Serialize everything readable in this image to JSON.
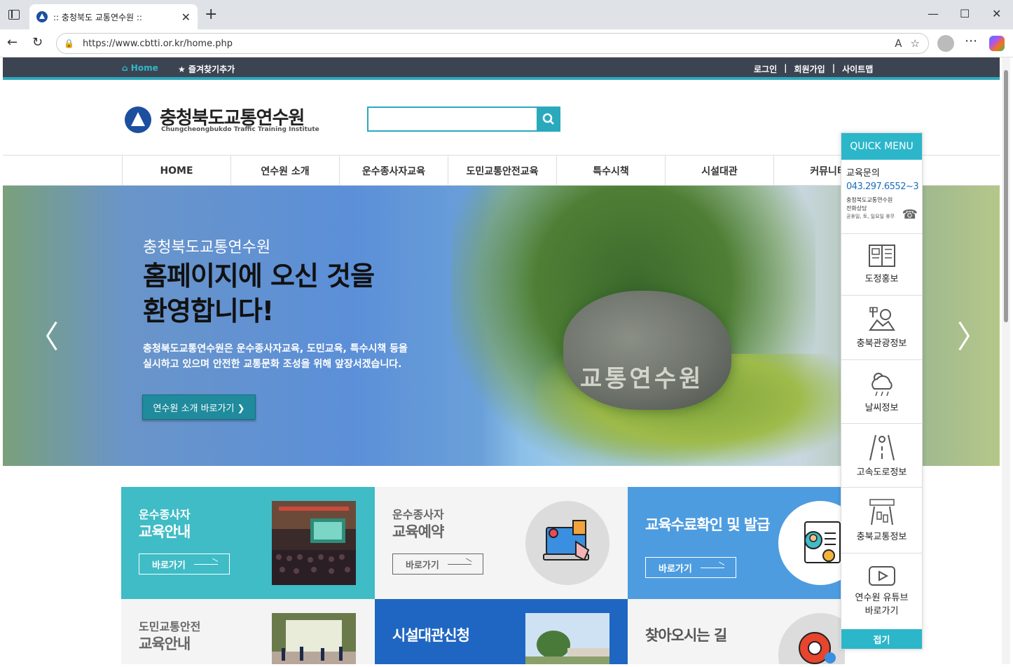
{
  "browser": {
    "tab_title": ":: 충청북도 교통연수원 ::",
    "url": "https://www.cbtti.or.kr/home.php"
  },
  "topbar": {
    "home": "Home",
    "bookmark": "★ 즐겨찾기추가",
    "login": "로그인",
    "join": "회원가입",
    "sitemap": "사이트맵",
    "separator": "|"
  },
  "header": {
    "logo_title": "충청북도교통연수원",
    "logo_subtitle": "Chungcheongbukdo Traffic Training Institute",
    "search_placeholder": ""
  },
  "gnb": {
    "items": [
      "HOME",
      "연수원 소개",
      "운수종사자교육",
      "도민교통안전교육",
      "특수시책",
      "시설대관",
      "커뮤니티"
    ]
  },
  "hero": {
    "small": "충청북도교통연수원",
    "big_line1": "홈페이지에 오신 것을",
    "big_line2": "환영합니다!",
    "desc_line1": "충청북도교통연수원은 운수종사자교육, 도민교육, 특수시책 등을",
    "desc_line2": "실시하고 있으며 안전한 교통문화 조성을 위해 앞장서겠습니다.",
    "button": "연수원 소개 바로가기 ❯",
    "stone_text": "교통연수원",
    "prev": "〈",
    "next": "〉"
  },
  "cards": [
    {
      "line1": "운수종사자",
      "line2": "교육안내",
      "more": "바로가기"
    },
    {
      "line1": "운수종사자",
      "line2": "교육예약",
      "more": "바로가기"
    },
    {
      "line1": "",
      "line2": "교육수료확인 및 발급",
      "more": "바로가기"
    },
    {
      "line1": "도민교통안전",
      "line2": "교육안내",
      "more": ""
    },
    {
      "line1": "",
      "line2": "시설대관신청",
      "more": ""
    },
    {
      "line1": "",
      "line2": "찾아오시는 길",
      "more": ""
    }
  ],
  "quick_menu": {
    "title": "QUICK MENU",
    "contact_label": "교육문의",
    "contact_phone": "043.297.6552~3",
    "contact_sub1": "충청북도교통연수원",
    "contact_sub2": "전화상담",
    "contact_note": "공휴일, 토, 일요일 휴무",
    "items": [
      "도정홍보",
      "충북관광정보",
      "날씨정보",
      "고속도로정보",
      "충북교통정보",
      "연수원 유튜브",
      "바로가기"
    ],
    "fold": "접기"
  },
  "colors": {
    "accent": "#2aa9bd",
    "topbar": "#3d4451",
    "card_teal": "#3fbcc6",
    "card_blue": "#4d9ce0",
    "card_darkblue": "#1f66c2"
  }
}
